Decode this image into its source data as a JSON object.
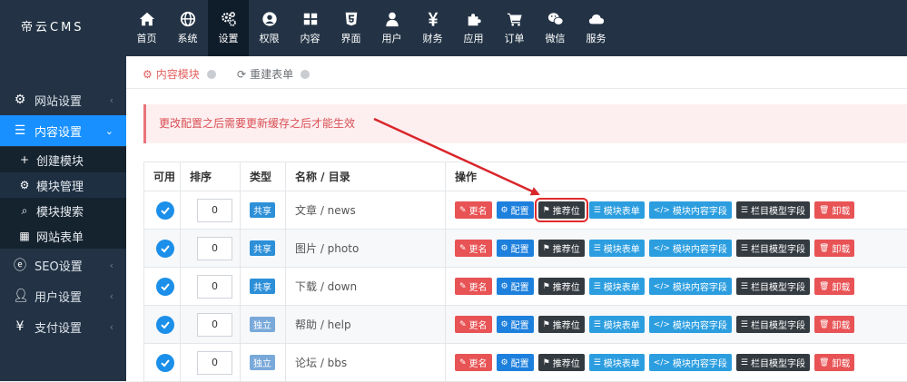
{
  "app": {
    "logo": "帝云CMS"
  },
  "topnav": [
    {
      "label": "首页",
      "icon": "home-icon"
    },
    {
      "label": "系统",
      "icon": "globe-icon"
    },
    {
      "label": "设置",
      "icon": "cogs-icon",
      "active": true
    },
    {
      "label": "权限",
      "icon": "user-circle-icon"
    },
    {
      "label": "内容",
      "icon": "grid-icon"
    },
    {
      "label": "界面",
      "icon": "html5-icon"
    },
    {
      "label": "用户",
      "icon": "user-icon"
    },
    {
      "label": "财务",
      "icon": "yen-icon"
    },
    {
      "label": "应用",
      "icon": "puzzle-icon"
    },
    {
      "label": "订单",
      "icon": "cart-icon"
    },
    {
      "label": "微信",
      "icon": "wechat-icon"
    },
    {
      "label": "服务",
      "icon": "cloud-icon"
    }
  ],
  "sidebar": {
    "items": [
      {
        "label": "网站设置",
        "icon": "gear-icon"
      },
      {
        "label": "内容设置",
        "icon": "list-icon",
        "open": true
      },
      {
        "label": "SEO设置",
        "icon": "ie-icon"
      },
      {
        "label": "用户设置",
        "icon": "user-icon"
      },
      {
        "label": "支付设置",
        "icon": "yen-icon"
      }
    ],
    "sub": [
      {
        "label": "创建模块",
        "icon": "plus-icon"
      },
      {
        "label": "模块管理",
        "icon": "cogs-icon",
        "active": true
      },
      {
        "label": "模块搜索",
        "icon": "search-icon"
      },
      {
        "label": "网站表单",
        "icon": "table-icon"
      }
    ]
  },
  "breadcrumb": [
    {
      "label": "内容模块"
    },
    {
      "label": "重建表单"
    }
  ],
  "notice": "更改配置之后需要更新缓存之后才能生效",
  "table": {
    "headers": [
      "可用",
      "排序",
      "类型",
      "名称 / 目录",
      "操作"
    ],
    "rows": [
      {
        "order": "0",
        "type": "共享",
        "type_kind": "share",
        "name": "文章 / news"
      },
      {
        "order": "0",
        "type": "共享",
        "type_kind": "share",
        "name": "图片 / photo"
      },
      {
        "order": "0",
        "type": "共享",
        "type_kind": "share",
        "name": "下载 / down"
      },
      {
        "order": "0",
        "type": "独立",
        "type_kind": "own",
        "name": "帮助 / help"
      },
      {
        "order": "0",
        "type": "独立",
        "type_kind": "own",
        "name": "论坛 / bbs"
      }
    ],
    "actions": [
      {
        "label": "更名",
        "icon": "edit-icon",
        "color": "#e85355"
      },
      {
        "label": "配置",
        "icon": "gear-icon",
        "color": "#1e80dd"
      },
      {
        "label": "推荐位",
        "icon": "flag-icon",
        "color": "#333a40"
      },
      {
        "label": "模块表单",
        "icon": "list-icon",
        "color": "#2c9ee0"
      },
      {
        "label": "模块内容字段",
        "icon": "code-icon",
        "color": "#2c9ee0"
      },
      {
        "label": "栏目模型字段",
        "icon": "list-icon",
        "color": "#333a40"
      },
      {
        "label": "卸载",
        "icon": "trash-icon",
        "color": "#e85355"
      }
    ]
  },
  "colors": {
    "nav_bg": "#233345",
    "accent": "#1890ff",
    "highlight": "#e12a2a"
  }
}
